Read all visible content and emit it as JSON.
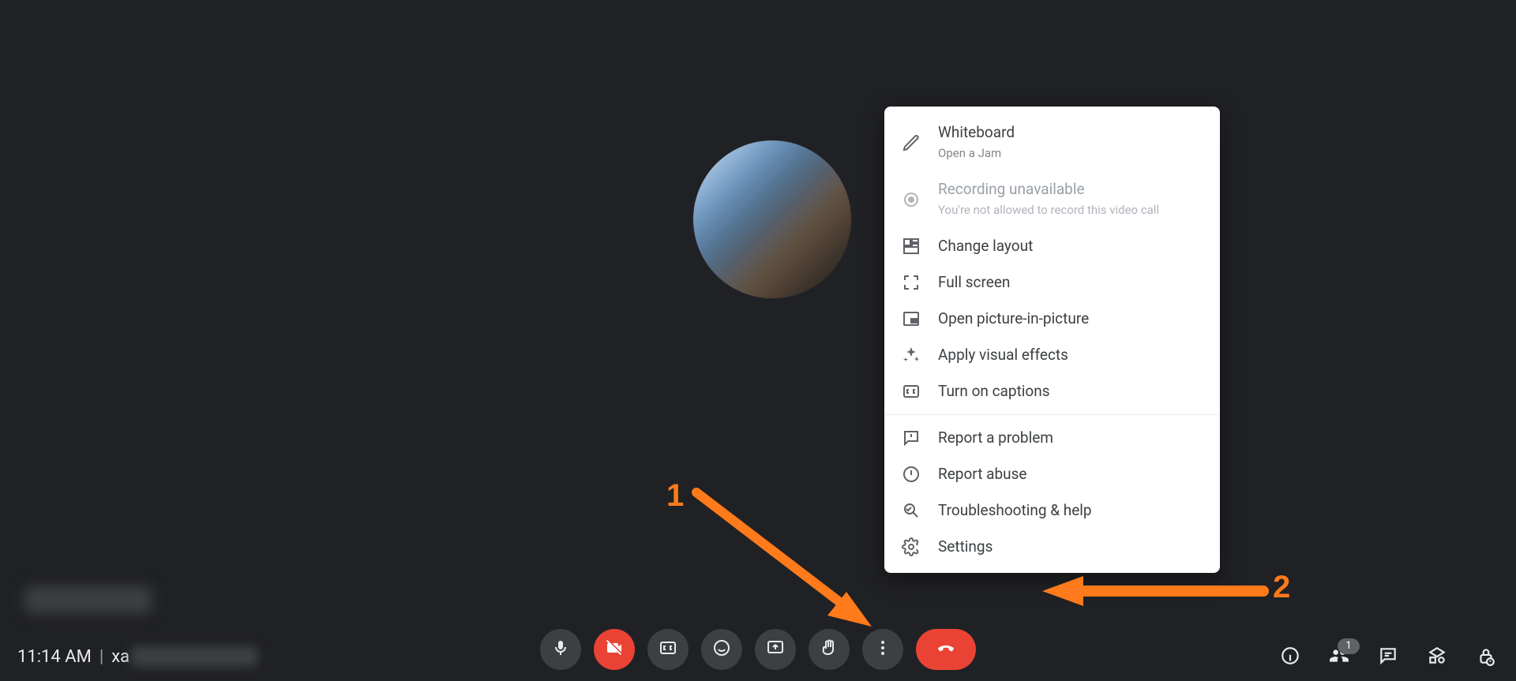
{
  "time": "11:14 AM",
  "meeting_code_prefix": "xa",
  "participants_badge": "1",
  "menu": {
    "whiteboard": {
      "label": "Whiteboard",
      "sub": "Open a Jam"
    },
    "recording": {
      "label": "Recording unavailable",
      "sub": "You're not allowed to record this video call"
    },
    "layout": {
      "label": "Change layout"
    },
    "fullscreen": {
      "label": "Full screen"
    },
    "pip": {
      "label": "Open picture-in-picture"
    },
    "effects": {
      "label": "Apply visual effects"
    },
    "captions": {
      "label": "Turn on captions"
    },
    "report": {
      "label": "Report a problem"
    },
    "abuse": {
      "label": "Report abuse"
    },
    "help": {
      "label": "Troubleshooting & help"
    },
    "settings": {
      "label": "Settings"
    }
  },
  "annotations": {
    "step1": "1",
    "step2": "2"
  }
}
